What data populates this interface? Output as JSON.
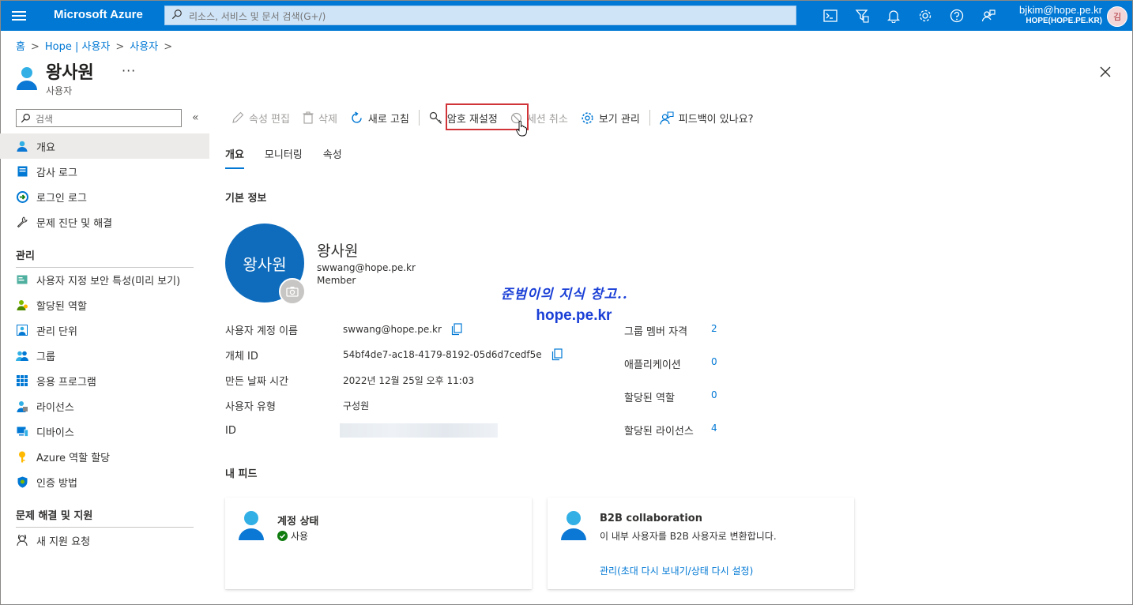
{
  "topbar": {
    "brand": "Microsoft Azure",
    "search_placeholder": "리소스, 서비스 및 문서 검색(G+/)",
    "account_email": "bjkim@hope.pe.kr",
    "account_tenant": "HOPE(HOPE.PE.KR)",
    "avatar_initial": "김",
    "icons": [
      "cloud-shell-icon",
      "directory-filter-icon",
      "notifications-icon",
      "settings-icon",
      "help-icon",
      "feedback-icon"
    ]
  },
  "breadcrumb": [
    "홈",
    "Hope | 사용자",
    "사용자"
  ],
  "page": {
    "title": "왕사원",
    "subtitle": "사용자",
    "more": "···"
  },
  "sidebar": {
    "search_placeholder": "검색",
    "collapse": "«",
    "items_top": [
      {
        "label": "개요",
        "icon": "user-icon",
        "active": true
      },
      {
        "label": "감사 로그",
        "icon": "audit-log-icon"
      },
      {
        "label": "로그인 로그",
        "icon": "signin-log-icon"
      },
      {
        "label": "문제 진단 및 해결",
        "icon": "wrench-icon"
      }
    ],
    "section_manage": "관리",
    "items_manage": [
      {
        "label": "사용자 지정 보안 특성(미리 보기)",
        "icon": "security-attributes-icon"
      },
      {
        "label": "할당된 역할",
        "icon": "assigned-roles-icon"
      },
      {
        "label": "관리 단위",
        "icon": "admin-units-icon"
      },
      {
        "label": "그룹",
        "icon": "groups-icon"
      },
      {
        "label": "응용 프로그램",
        "icon": "applications-icon"
      },
      {
        "label": "라이선스",
        "icon": "licenses-icon"
      },
      {
        "label": "디바이스",
        "icon": "devices-icon"
      },
      {
        "label": "Azure 역할 할당",
        "icon": "azure-role-icon"
      },
      {
        "label": "인증 방법",
        "icon": "auth-methods-icon"
      }
    ],
    "section_support": "문제 해결 및 지원",
    "items_support": [
      {
        "label": "새 지원 요청",
        "icon": "support-request-icon"
      }
    ]
  },
  "toolbar": {
    "edit": "속성 편집",
    "delete": "삭제",
    "refresh": "새로 고침",
    "reset_password": "암호 재설정",
    "revoke_sessions": "세션 취소",
    "manage_view": "보기 관리",
    "feedback": "피드백이 있나요?"
  },
  "tabs": [
    "개요",
    "모니터링",
    "속성"
  ],
  "basic_info": {
    "section": "기본 정보",
    "avatar_text": "왕사원",
    "name": "왕사원",
    "email": "swwang@hope.pe.kr",
    "type": "Member"
  },
  "watermark": {
    "line1": "준범이의 지식 창고..",
    "line2": "hope.pe.kr"
  },
  "properties": [
    {
      "label": "사용자 계정 이름",
      "value": "swwang@hope.pe.kr",
      "copy": true
    },
    {
      "label": "개체 ID",
      "value": "54bf4de7-ac18-4179-8192-05d6d7cedf5e",
      "copy": true
    },
    {
      "label": "만든 날짜 시간",
      "value": "2022년 12월 25일 오후 11:03"
    },
    {
      "label": "사용자 유형",
      "value": "구성원"
    },
    {
      "label": "ID",
      "value": ""
    }
  ],
  "stats": [
    {
      "label": "그룹 멤버 자격",
      "value": "2"
    },
    {
      "label": "애플리케이션",
      "value": "0"
    },
    {
      "label": "할당된 역할",
      "value": "0"
    },
    {
      "label": "할당된 라이선스",
      "value": "4"
    }
  ],
  "feed": {
    "section": "내 피드",
    "account_status": {
      "title": "계정 상태",
      "status": "사용"
    },
    "b2b": {
      "title": "B2B collaboration",
      "text": "이 내부 사용자를 B2B 사용자로 변환합니다.",
      "link": "관리(초대 다시 보내기/상태 다시 설정)"
    }
  },
  "colors": {
    "accent": "#0078d4",
    "highlight": "#d13438",
    "status_ok": "#107c10",
    "watermark": "#1a3fd6"
  }
}
